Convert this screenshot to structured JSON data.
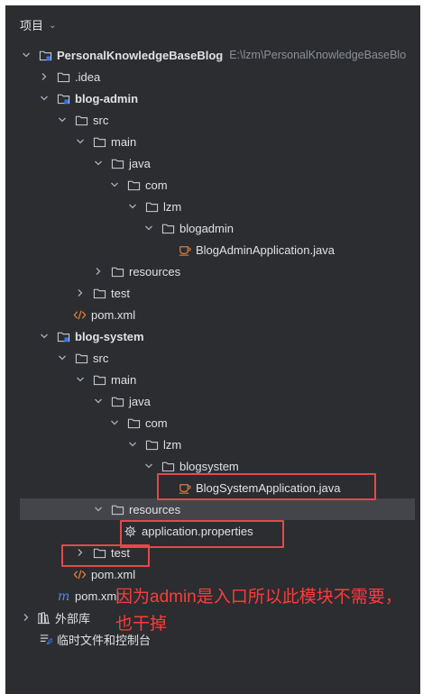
{
  "panel": {
    "title": "项目"
  },
  "tree": {
    "root_name": "PersonalKnowledgeBaseBlog",
    "root_path": "E:\\lzm\\PersonalKnowledgeBaseBlo",
    "idea": ".idea",
    "admin": {
      "module": "blog-admin",
      "src": "src",
      "main": "main",
      "java": "java",
      "com": "com",
      "lzm": "lzm",
      "pkg": "blogadmin",
      "app_class": "BlogAdminApplication.java",
      "resources": "resources",
      "test": "test",
      "pom": "pom.xml"
    },
    "system": {
      "module": "blog-system",
      "src": "src",
      "main": "main",
      "java": "java",
      "com": "com",
      "lzm": "lzm",
      "pkg": "blogsystem",
      "app_class": "BlogSystemApplication.java",
      "resources": "resources",
      "props": "application.properties",
      "test": "test",
      "pom": "pom.xml"
    },
    "root_pom": "pom.xml",
    "external_libs": "外部库",
    "scratches": "临时文件和控制台"
  },
  "annotation": {
    "text": "因为admin是入口所以此模块不需要，也干掉"
  },
  "colors": {
    "panel_bg": "#2b2d30",
    "text": "#dfe1e5",
    "muted": "#8c8f96",
    "highlight_box": "#e5484d",
    "annotation_text": "#ff3b3b",
    "selected_row": "#43454a"
  }
}
